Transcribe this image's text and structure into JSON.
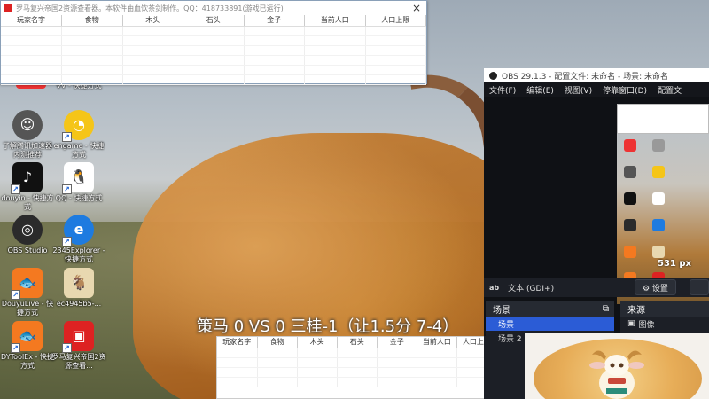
{
  "desktop": {
    "icons": [
      {
        "label": "",
        "icon": "tencent-icon",
        "color": "#e33"
      },
      {
        "label": "VV - 快捷方式",
        "icon": "vv-icon",
        "color": "#555"
      },
      {
        "label": "了解腾讯加速器内测推荐",
        "icon": "accelerator-icon",
        "color": "#666"
      },
      {
        "label": "engame - 快捷方式",
        "icon": "engame-icon",
        "color": "#f5c518"
      },
      {
        "label": "douyin - 快捷方式",
        "icon": "douyin-icon",
        "color": "#111"
      },
      {
        "label": "QQ - 快捷方式",
        "icon": "qq-icon",
        "color": "#fff"
      },
      {
        "label": "OBS Studio",
        "icon": "obs-icon",
        "color": "#2b2b2b"
      },
      {
        "label": "2345Explorer - 快捷方式",
        "icon": "ie-icon",
        "color": "#1e7be0"
      },
      {
        "label": "DouyuLive - 快捷方式",
        "icon": "douyu-icon",
        "color": "#f47920"
      },
      {
        "label": "ec4945b5-...",
        "icon": "goat-icon",
        "color": "#e8d8b0"
      },
      {
        "label": "DYToolEx - 快捷方式",
        "icon": "dytool-icon",
        "color": "#f47920"
      },
      {
        "label": "罗马复兴帝国2资源查看...",
        "icon": "rome-icon",
        "color": "#d22"
      }
    ]
  },
  "viewer": {
    "title": "罗马复兴帝国2资源查看器。本软件由血饮茶剑制作。QQ：418733891(游戏已运行)",
    "close": "×",
    "columns": [
      "玩家名字",
      "食物",
      "木头",
      "石头",
      "金子",
      "当前人口",
      "人口上限"
    ]
  },
  "overlay": {
    "text": "策马 0 VS 0 三桂-1（让1.5分 7-4）"
  },
  "obs": {
    "title": "OBS 29.1.3 - 配置文件: 未命名 - 场景: 未命名",
    "menu": [
      "文件(F)",
      "编辑(E)",
      "视图(V)",
      "停靠窗口(D)",
      "配置文"
    ],
    "preview_size_label": "531 px",
    "source_tag": "ab",
    "source_name": "文本 (GDI+)",
    "settings_label": "⚙ 设置",
    "scenes_header": "场景",
    "scenes": [
      "场景",
      "场景 2"
    ],
    "sources_header": "来源",
    "sources": [
      "图像"
    ]
  },
  "colors": {
    "scene_selected": "#2b5cd6",
    "obs_bg": "#1c1f26"
  }
}
